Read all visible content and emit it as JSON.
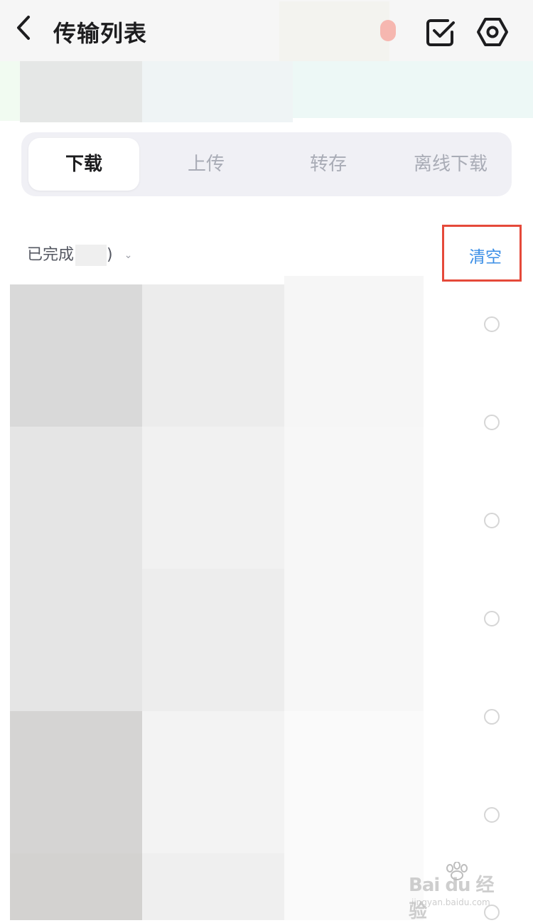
{
  "header": {
    "title": "传输列表",
    "back_icon": "chevron-left-icon",
    "select_icon": "checkbox-icon",
    "settings_icon": "gear-icon"
  },
  "tabs": [
    {
      "label": "下载",
      "active": true
    },
    {
      "label": "上传",
      "active": false
    },
    {
      "label": "转存",
      "active": false
    },
    {
      "label": "离线下载",
      "active": false
    }
  ],
  "filter": {
    "label": "已完成",
    "paren_close": ")"
  },
  "clear_label": "清空",
  "colors": {
    "accent": "#3a8ee6",
    "highlight": "#e5493a",
    "active_tab_text": "#1d1d1f",
    "inactive_tab_text": "#a9acb6"
  },
  "watermark": {
    "main": "Bai du 经验",
    "sub": "jingyan.baidu.com"
  }
}
